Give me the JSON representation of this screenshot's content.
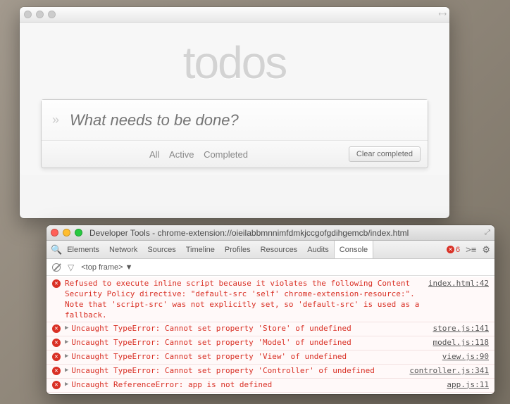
{
  "app": {
    "title": "todos",
    "input_placeholder": "What needs to be done?",
    "filters": {
      "all": "All",
      "active": "Active",
      "completed": "Completed"
    },
    "clear_completed": "Clear completed"
  },
  "devtools": {
    "title": "Developer Tools - chrome-extension://oieilabbmnnimfdmkjccgofgdihgemcb/index.html",
    "tabs": [
      "Elements",
      "Network",
      "Sources",
      "Timeline",
      "Profiles",
      "Resources",
      "Audits",
      "Console"
    ],
    "active_tab": "Console",
    "error_count": "6",
    "toolbar": {
      "frame": "<top frame> ▼"
    },
    "logs": [
      {
        "expandable": false,
        "message": "Refused to execute inline script because it violates the following Content Security Policy directive: \"default-src 'self' chrome-extension-resource:\". Note that 'script-src' was not explicitly set, so 'default-src' is used as a fallback.",
        "source": "index.html:42"
      },
      {
        "expandable": true,
        "message": "Uncaught TypeError: Cannot set property 'Store' of undefined",
        "source": "store.js:141"
      },
      {
        "expandable": true,
        "message": "Uncaught TypeError: Cannot set property 'Model' of undefined",
        "source": "model.js:118"
      },
      {
        "expandable": true,
        "message": "Uncaught TypeError: Cannot set property 'View' of undefined",
        "source": "view.js:90"
      },
      {
        "expandable": true,
        "message": "Uncaught TypeError: Cannot set property 'Controller' of undefined",
        "source": "controller.js:341"
      },
      {
        "expandable": true,
        "message": "Uncaught ReferenceError: app is not defined",
        "source": "app.js:11"
      }
    ]
  }
}
